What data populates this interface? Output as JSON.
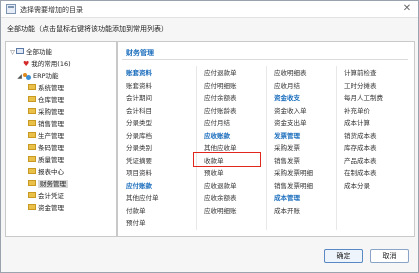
{
  "window": {
    "title": "选择需要增加的目录",
    "close_label": "✕"
  },
  "subtitle": "全部功能（点击鼠标右键将该功能添加到常用列表）",
  "tree": {
    "root": "全部功能",
    "favorites": "我的常用(16)",
    "erp": "ERP功能",
    "modules": [
      "系统管理",
      "仓库管理",
      "采购管理",
      "销售管理",
      "生产管理",
      "条码管理",
      "质量管理",
      "报表中心",
      "财务管理",
      "会计凭证",
      "资金管理"
    ],
    "selected": "财务管理"
  },
  "panel": {
    "title": "财务管理",
    "columns": [
      {
        "blocks": [
          {
            "head": "账套资料",
            "items": [
              "账套资料",
              "会计期间",
              "会计科目",
              "分录类型",
              "分录库档",
              "分录类别",
              "凭证摘要",
              "项目资料"
            ]
          },
          {
            "head": "应付账款",
            "items": [
              "其他应付单",
              "付款单",
              "预付单"
            ]
          }
        ]
      },
      {
        "blocks": [
          {
            "head": "",
            "items": [
              "应付退款单",
              "应付明细账",
              "应付余额表",
              "应付账龄表",
              "应付月结"
            ]
          },
          {
            "head": "应收账款",
            "items": [
              "其他应收单",
              "收款单",
              "预收单",
              "应收退款单",
              "应收余额表",
              "应收明细账"
            ]
          }
        ]
      },
      {
        "blocks": [
          {
            "head": "",
            "items": [
              "应收明细表",
              "应收月结"
            ]
          },
          {
            "head": "资金收支",
            "items": [
              "资金收入单",
              "资金支出单"
            ]
          },
          {
            "head": "发票管理",
            "items": [
              "采购发票",
              "销售发票",
              "采购发票明细",
              "销售发票明细"
            ]
          },
          {
            "head": "成本管理",
            "items": [
              "成本开账"
            ]
          }
        ]
      },
      {
        "blocks": [
          {
            "head": "",
            "items": [
              "计算前检查",
              "工时分摊表",
              "每月人工制费",
              "补充单价",
              "成本计算",
              "销货成本表",
              "库存成本表",
              "产品成本表",
              "在制成本表",
              "成本分录"
            ]
          }
        ]
      }
    ],
    "highlighted_item": "其他应收单"
  },
  "buttons": {
    "ok": "确定",
    "cancel": "取消"
  }
}
